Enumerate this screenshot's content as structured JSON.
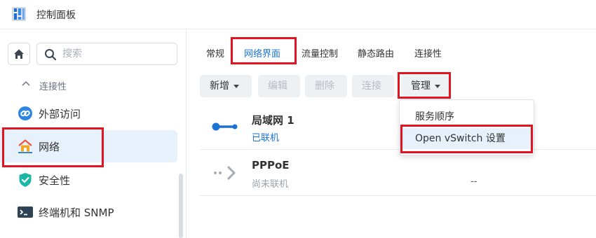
{
  "window": {
    "title": "控制面板"
  },
  "sidebar": {
    "search_placeholder": "搜索",
    "section_label": "连接性",
    "items": [
      {
        "label": "外部访问",
        "icon": "external-access-icon"
      },
      {
        "label": "网络",
        "icon": "network-house-icon",
        "active": true
      },
      {
        "label": "安全性",
        "icon": "security-shield-icon"
      },
      {
        "label": "终端机和 SNMP",
        "icon": "terminal-icon"
      }
    ]
  },
  "tabs": [
    {
      "label": "常规"
    },
    {
      "label": "网络界面",
      "active": true
    },
    {
      "label": "流量控制"
    },
    {
      "label": "静态路由"
    },
    {
      "label": "连接性"
    }
  ],
  "toolbar": {
    "create": "新增",
    "edit": "编辑",
    "delete": "删除",
    "connect": "连接",
    "manage": "管理"
  },
  "interfaces": [
    {
      "name": "局域网 1",
      "status": "已联机",
      "status_color": "#1a73d4",
      "extra": ""
    },
    {
      "name": "PPPoE",
      "status": "尚未联机",
      "status_color": "#9aa2ab",
      "extra": "--"
    }
  ],
  "manage_menu": [
    {
      "label": "服务顺序"
    },
    {
      "label": "Open vSwitch 设置",
      "highlighted": true
    }
  ],
  "colors": {
    "accent": "#1a73d4",
    "annotation_box": "#e3141f",
    "active_bg": "#e7f1fb"
  }
}
